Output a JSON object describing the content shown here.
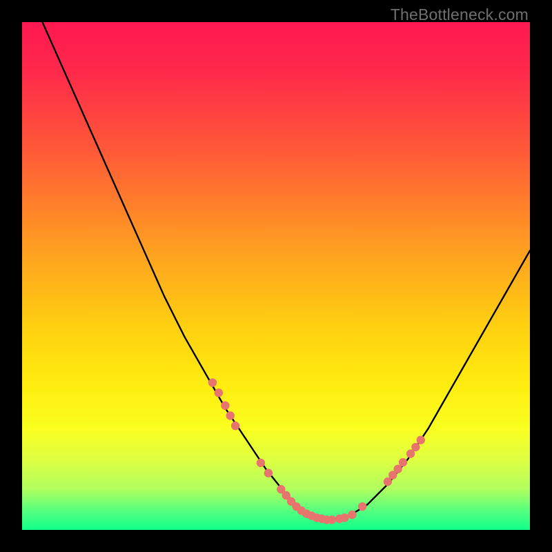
{
  "watermark": {
    "text": "TheBottleneck.com"
  },
  "gradient": {
    "steps": [
      {
        "stop": 0.0,
        "color": "#ff1850"
      },
      {
        "stop": 0.1,
        "color": "#ff2a4a"
      },
      {
        "stop": 0.25,
        "color": "#ff5838"
      },
      {
        "stop": 0.45,
        "color": "#ffa020"
      },
      {
        "stop": 0.6,
        "color": "#ffd010"
      },
      {
        "stop": 0.72,
        "color": "#ffee10"
      },
      {
        "stop": 0.8,
        "color": "#faff20"
      },
      {
        "stop": 0.86,
        "color": "#e0ff40"
      },
      {
        "stop": 0.92,
        "color": "#b0ff60"
      },
      {
        "stop": 0.965,
        "color": "#50ff80"
      },
      {
        "stop": 1.0,
        "color": "#10ff8a"
      }
    ]
  },
  "chart_data": {
    "type": "line",
    "title": "",
    "xlabel": "",
    "ylabel": "",
    "xlim": [
      0,
      100
    ],
    "ylim": [
      0,
      100
    ],
    "series": [
      {
        "name": "bottleneck-curve",
        "x": [
          4,
          8,
          12,
          16,
          20,
          24,
          28,
          32,
          36,
          40,
          44,
          48,
          52,
          54,
          56,
          58,
          60,
          62,
          64,
          68,
          72,
          76,
          80,
          84,
          88,
          92,
          96,
          100
        ],
        "y": [
          100,
          91,
          82,
          73,
          64,
          55,
          46,
          38,
          31,
          24,
          18,
          12,
          7,
          5,
          3.5,
          2.5,
          2,
          2,
          2.5,
          5,
          9,
          14,
          20,
          27,
          34,
          41,
          48,
          55
        ],
        "stroke": "#000000",
        "stroke_width": 2.4
      }
    ],
    "markers": {
      "color": "#e7746d",
      "radius": 6.2,
      "points": [
        {
          "x": 37.5,
          "y": 29
        },
        {
          "x": 38.7,
          "y": 27
        },
        {
          "x": 40.0,
          "y": 24.5
        },
        {
          "x": 41.0,
          "y": 22.5
        },
        {
          "x": 42.0,
          "y": 20.5
        },
        {
          "x": 47.0,
          "y": 13.2
        },
        {
          "x": 48.5,
          "y": 11.2
        },
        {
          "x": 51.0,
          "y": 8.0
        },
        {
          "x": 52.0,
          "y": 6.8
        },
        {
          "x": 53.0,
          "y": 5.6
        },
        {
          "x": 54.0,
          "y": 4.6
        },
        {
          "x": 55.0,
          "y": 3.8
        },
        {
          "x": 56.0,
          "y": 3.2
        },
        {
          "x": 57.0,
          "y": 2.8
        },
        {
          "x": 58.0,
          "y": 2.4
        },
        {
          "x": 59.0,
          "y": 2.2
        },
        {
          "x": 60.0,
          "y": 2.0
        },
        {
          "x": 61.0,
          "y": 2.0
        },
        {
          "x": 62.5,
          "y": 2.2
        },
        {
          "x": 63.5,
          "y": 2.4
        },
        {
          "x": 65.0,
          "y": 3.0
        },
        {
          "x": 67.0,
          "y": 4.6
        },
        {
          "x": 72.0,
          "y": 9.5
        },
        {
          "x": 73.0,
          "y": 10.8
        },
        {
          "x": 74.0,
          "y": 12.0
        },
        {
          "x": 75.0,
          "y": 13.3
        },
        {
          "x": 76.5,
          "y": 15.0
        },
        {
          "x": 77.5,
          "y": 16.3
        },
        {
          "x": 78.5,
          "y": 17.7
        }
      ]
    }
  }
}
